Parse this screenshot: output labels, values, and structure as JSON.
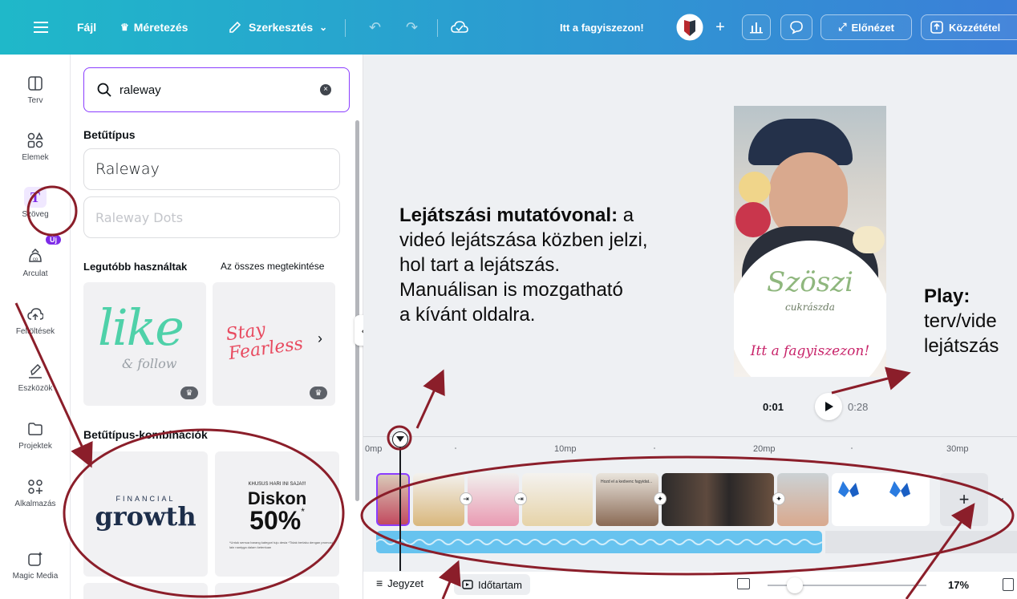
{
  "topbar": {
    "menu_icon": "hamburger-icon",
    "file": "Fájl",
    "resize": "Méretezés",
    "edit": "Szerkesztés",
    "title": "Itt a fagyiszezon!",
    "preview": "Előnézet",
    "publish": "Közzététel"
  },
  "rail": {
    "items": [
      {
        "label": "Terv",
        "icon": "layout-icon"
      },
      {
        "label": "Elemek",
        "icon": "shapes-icon"
      },
      {
        "label": "Szöveg",
        "icon": "text-icon"
      },
      {
        "label": "Arculat",
        "icon": "brand-icon",
        "badge": "Új"
      },
      {
        "label": "Feltöltések",
        "icon": "upload-icon"
      },
      {
        "label": "Eszközök",
        "icon": "draw-icon"
      },
      {
        "label": "Projektek",
        "icon": "folder-icon"
      },
      {
        "label": "Alkalmazás",
        "icon": "apps-icon"
      },
      {
        "label": "Magic Media",
        "icon": "magic-icon"
      }
    ]
  },
  "panel": {
    "search_value": "raleway",
    "fonts_heading": "Betűtípus",
    "font1": "Raleway",
    "font2": "Raleway Dots",
    "recent_heading": "Legutóbb használtak",
    "see_all": "Az összes megtekintése",
    "recent1_main": "like",
    "recent1_sub": "& follow",
    "recent2_main": "Stay Fearless",
    "combos_heading": "Betűtípus-kombinációk",
    "combo1_top": "FINANCIAL",
    "combo1_main": "growth",
    "combo2_top": "KHUSUS HARI INI SAJA!!!",
    "combo2_main": "Diskon",
    "combo2_value": "50%",
    "combo2_star": "*",
    "combo2_fine": "*Untuk semua barang kategori tuju desia *Tidak berlaku dengan promosi lain nantyga dalam ketentuan"
  },
  "preview": {
    "brand": "Szöszi",
    "brand_sub": "cukrászda",
    "slogan": "Itt a fagyiszezon!",
    "time_current": "0:01",
    "time_total": "0:28"
  },
  "annotations": {
    "playhead_title": "Lejátszási mutatóvonal:",
    "playhead_rest1": " a",
    "playhead_lines": [
      "videó lejátszása közben jelzi,",
      "hol tart a lejátszás.",
      "Manuálisan is mozgatható",
      "a kívánt oldalra."
    ],
    "play_title": "Play:",
    "play_lines": [
      "terv/vide",
      "lejátszás"
    ]
  },
  "timeline": {
    "ticks": [
      "0mp",
      "10mp",
      "20mp",
      "30mp"
    ],
    "clip_caption": "Hozd el a kedvenc fagyidat..."
  },
  "bottom": {
    "notes": "Jegyzet",
    "duration": "Időtartam",
    "zoom": "17%"
  },
  "colors": {
    "accent": "#8b3dff",
    "annotation": "#8b1e2a",
    "audio": "#67c3ef"
  }
}
